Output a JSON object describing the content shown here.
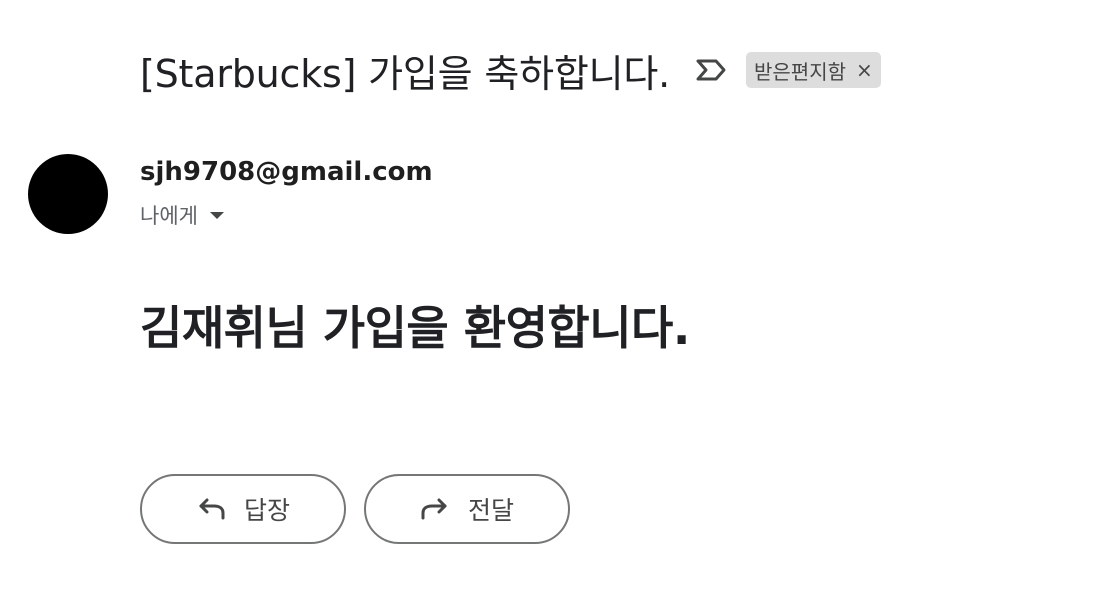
{
  "subject": {
    "title": "[Starbucks] 가입을 축하합니다.",
    "important_icon": "important-marker-icon",
    "label": "받은편지함",
    "label_close_glyph": "×"
  },
  "sender": {
    "avatar_color": "#000000",
    "email": "sjh9708@gmail.com",
    "recipient_text": "나에게",
    "dropdown_icon": "caret-down-icon"
  },
  "message": {
    "heading": "김재휘님 가입을 환영합니다."
  },
  "actions": {
    "reply_label": "답장",
    "reply_icon": "reply-arrow-icon",
    "forward_label": "전달",
    "forward_icon": "forward-arrow-icon"
  },
  "colors": {
    "text": "#202124",
    "chip_bg": "#dddddd",
    "button_border": "#747775"
  }
}
